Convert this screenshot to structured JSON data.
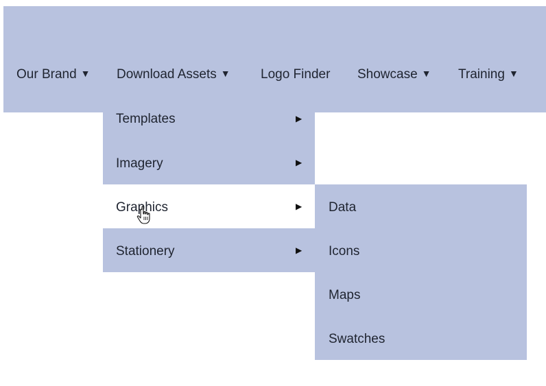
{
  "nav": {
    "items": [
      {
        "label": "Our Brand",
        "caret": "▼"
      },
      {
        "label": "Download Assets",
        "caret": "▼"
      },
      {
        "label": "Logo Finder",
        "caret": ""
      },
      {
        "label": "Showcase",
        "caret": "▼"
      },
      {
        "label": "Training",
        "caret": "▼"
      }
    ]
  },
  "download_assets_menu": {
    "items": [
      {
        "label": "Templates",
        "arrow": "▶"
      },
      {
        "label": "Imagery",
        "arrow": "▶"
      },
      {
        "label": "Graphics",
        "arrow": "▶"
      },
      {
        "label": "Stationery",
        "arrow": "▶"
      }
    ],
    "active_item": "Graphics"
  },
  "graphics_submenu": {
    "items": [
      {
        "label": "Data"
      },
      {
        "label": "Icons"
      },
      {
        "label": "Maps"
      },
      {
        "label": "Swatches"
      }
    ]
  },
  "colors": {
    "menu_bg": "#b8c2df",
    "active_bg": "#ffffff",
    "text": "#1f2430"
  },
  "icons": {
    "caret": "caret-down-icon",
    "submenu_arrow": "caret-right-icon",
    "cursor": "hand-pointer-icon"
  }
}
